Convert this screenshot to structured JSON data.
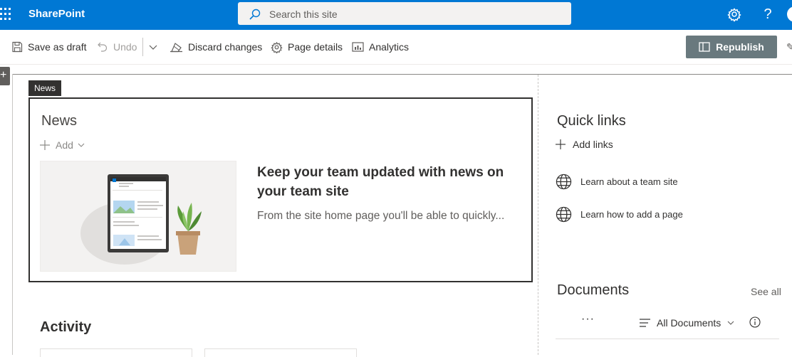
{
  "suite": {
    "app_name": "SharePoint",
    "search_placeholder": "Search this site",
    "help_glyph": "?",
    "accent": "#0078d4"
  },
  "commands": {
    "save_draft": "Save as draft",
    "undo": "Undo",
    "discard": "Discard changes",
    "page_details": "Page details",
    "analytics": "Analytics",
    "republish": "Republish"
  },
  "left_toolbox_glyph": "+",
  "news": {
    "tag": "News",
    "title": "News",
    "add_label": "Add",
    "headline": "Keep your team updated with news on your team site",
    "snippet": "From the site home page you'll be able to quickly..."
  },
  "activity": {
    "title": "Activity"
  },
  "quick_links": {
    "title": "Quick links",
    "add_label": "Add links",
    "items": [
      {
        "label": "Learn about a team site",
        "icon": "globe-icon"
      },
      {
        "label": "Learn how to add a page",
        "icon": "globe-icon"
      }
    ]
  },
  "documents": {
    "title": "Documents",
    "see_all": "See all",
    "more_glyph": "···",
    "view_label": "All Documents"
  }
}
